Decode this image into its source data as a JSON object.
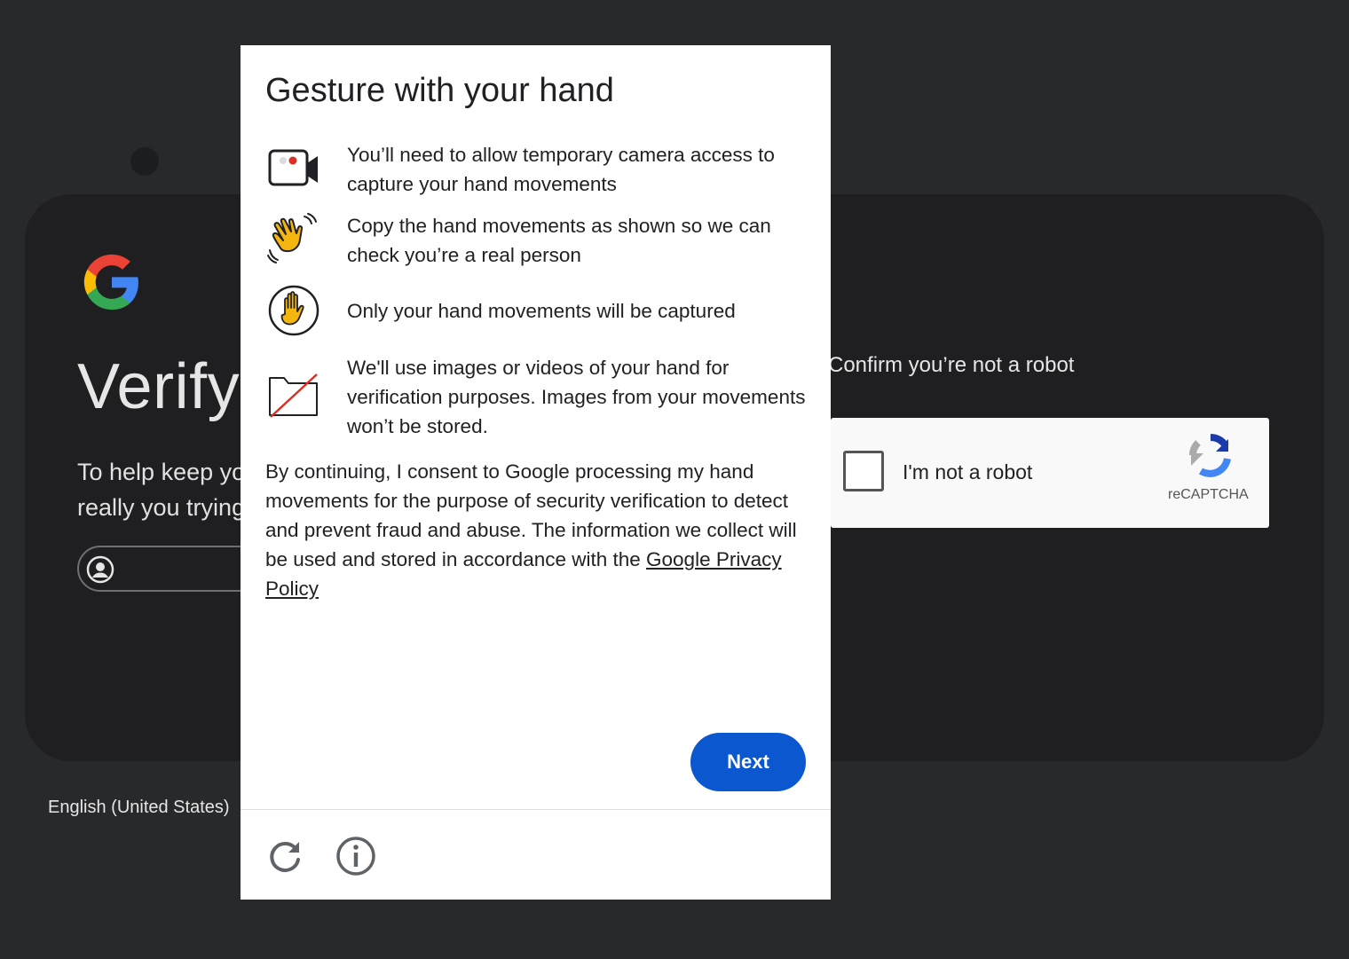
{
  "background": {
    "title": "Verify",
    "subtitle": "To help keep yo\nreally you trying",
    "confirm_label": "Confirm you’re not a robot",
    "recaptcha": {
      "checkbox_label": "I'm not a robot",
      "brand": "reCAPTCHA"
    },
    "language": "English (United States)"
  },
  "modal": {
    "title": "Gesture with your hand",
    "items": [
      {
        "icon": "camera-icon",
        "text": "You’ll need to allow temporary camera access to capture your hand movements"
      },
      {
        "icon": "waving-hand-icon",
        "text": "Copy the hand movements as shown so we can check you’re a real person"
      },
      {
        "icon": "hand-circle-icon",
        "text": "Only your hand movements will be captured"
      },
      {
        "icon": "folder-off-icon",
        "text": "We'll use images or videos of your hand for verification purposes. Images from your movements won’t be stored."
      }
    ],
    "consent_text": "By continuing, I consent to Google processing my hand movements for the purpose of security verification to detect and prevent fraud and abuse. The information we collect will be used and stored in accordance with the ",
    "privacy_link": "Google Privacy Policy",
    "next_label": "Next",
    "footer_icons": [
      "reload-icon",
      "info-icon"
    ]
  },
  "colors": {
    "page_bg": "#28292b",
    "card_bg": "#1f1f21",
    "primary_button": "#0b57d0",
    "hand_yellow": "#f5b50f"
  }
}
